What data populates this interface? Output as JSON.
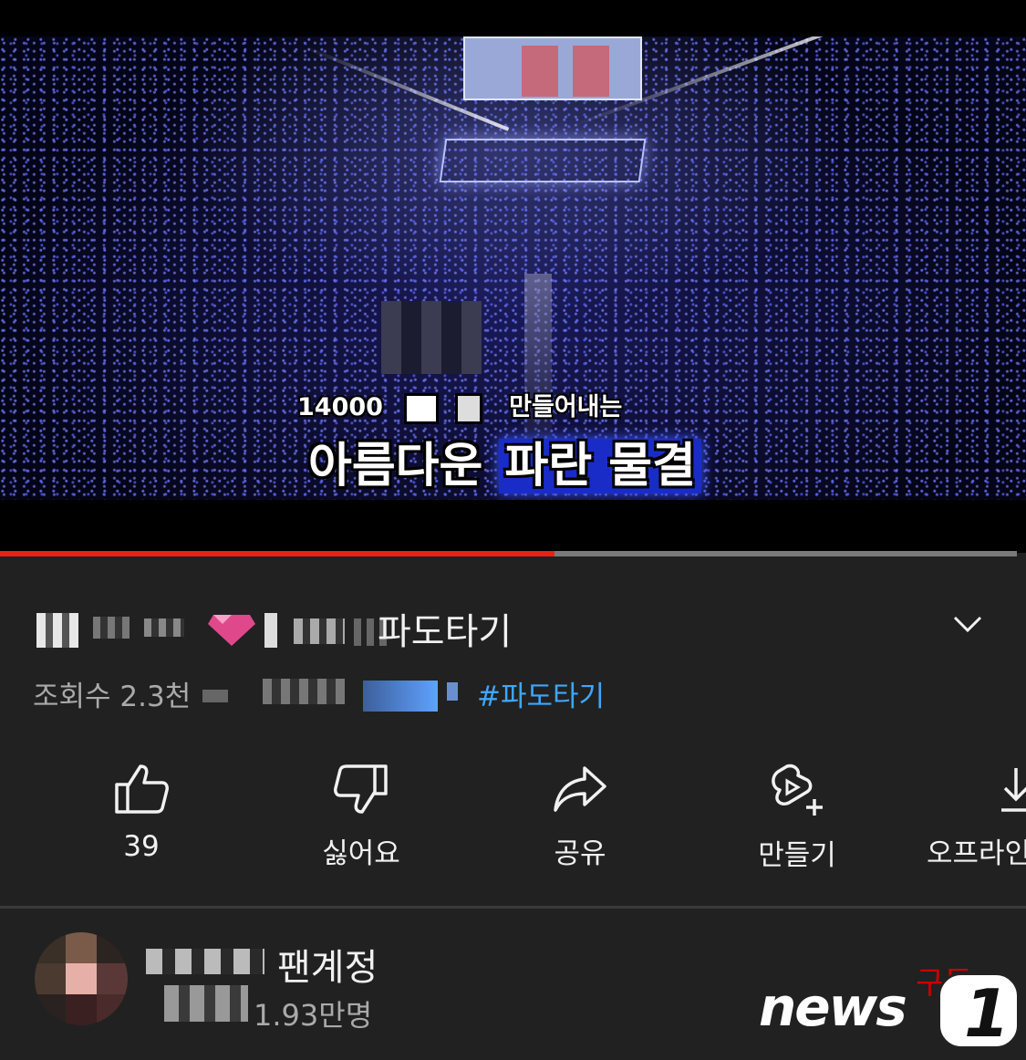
{
  "video": {
    "caption_line1": "14000 만들어내는",
    "caption_line2_prefix": "아름다운",
    "caption_line2_highlight": "파란 물결",
    "progress": 0.545
  },
  "info": {
    "title_suffix": "파도타기",
    "views": "조회수 2.3천",
    "hashtag": "#파도타기"
  },
  "actions": [
    {
      "icon": "thumbs-up-icon",
      "label": "39"
    },
    {
      "icon": "thumbs-down-icon",
      "label": "싫어요"
    },
    {
      "icon": "share-icon",
      "label": "공유"
    },
    {
      "icon": "remix-icon",
      "label": "만들기"
    },
    {
      "icon": "download-icon",
      "label": "오프라인"
    }
  ],
  "channel": {
    "name": "팬계정",
    "subscribers": "1.93만명",
    "subscribe_label": "구독"
  },
  "watermark": {
    "text": "news",
    "digit": "1"
  },
  "colors": {
    "background": "#212121",
    "progress_played": "#e62117",
    "hashtag": "#3ea6ff",
    "caption_highlight": "#1a2cc8"
  }
}
